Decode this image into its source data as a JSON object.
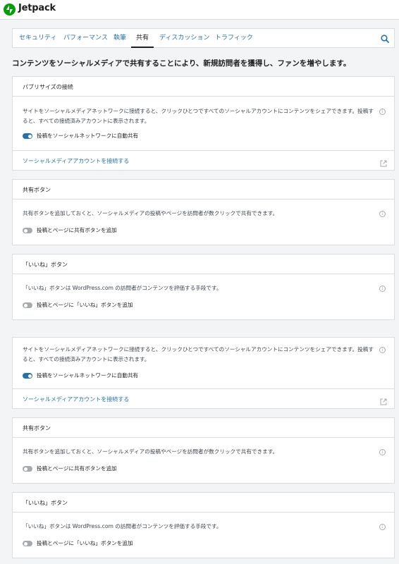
{
  "app": {
    "brand": "Jetpack",
    "logo_icon": "jetpack-bolt-icon"
  },
  "nav": {
    "tabs": [
      {
        "label": "セキュリティ"
      },
      {
        "label": "パフォーマンス"
      },
      {
        "label": "執筆"
      },
      {
        "label": "共有",
        "active": true
      },
      {
        "label": "ディスカッション"
      },
      {
        "label": "トラフィック"
      }
    ],
    "search_icon": "search-icon"
  },
  "headline": "コンテンツをソーシャルメディアで共有することにより、新規訪問者を獲得し、ファンを増やします。",
  "publicize": {
    "title": "パブリサイズの接続",
    "description": "サイトをソーシャルメディアネットワークに接続すると、クリックひとつですべてのソーシャルアカウントにコンテンツをシェアできます。投稿すると、すべての接続済みアカウントに表示されます。",
    "toggle_label": "投稿をソーシャルネットワークに自動共有",
    "toggle_on": true,
    "link": "ソーシャルメディアアカウントを接続する"
  },
  "sharing": {
    "title": "共有ボタン",
    "description": "共有ボタンを追加しておくと、ソーシャルメディアの投稿やページを訪問者が数クリックで共有できます。",
    "toggle_label": "投稿とページに共有ボタンを追加",
    "toggle_on": false
  },
  "likes": {
    "title": "「いいね」ボタン",
    "description": "「いいね」ボタンは WordPress.com の訪問者がコンテンツを評価する手段です。",
    "toggle_label": "投稿とページに「いいね」ボタンを追加",
    "toggle_on": false
  },
  "colors": {
    "accent": "#2271b1",
    "brand": "#069e08",
    "border": "#dcdcde",
    "background": "#f3f4f5"
  }
}
